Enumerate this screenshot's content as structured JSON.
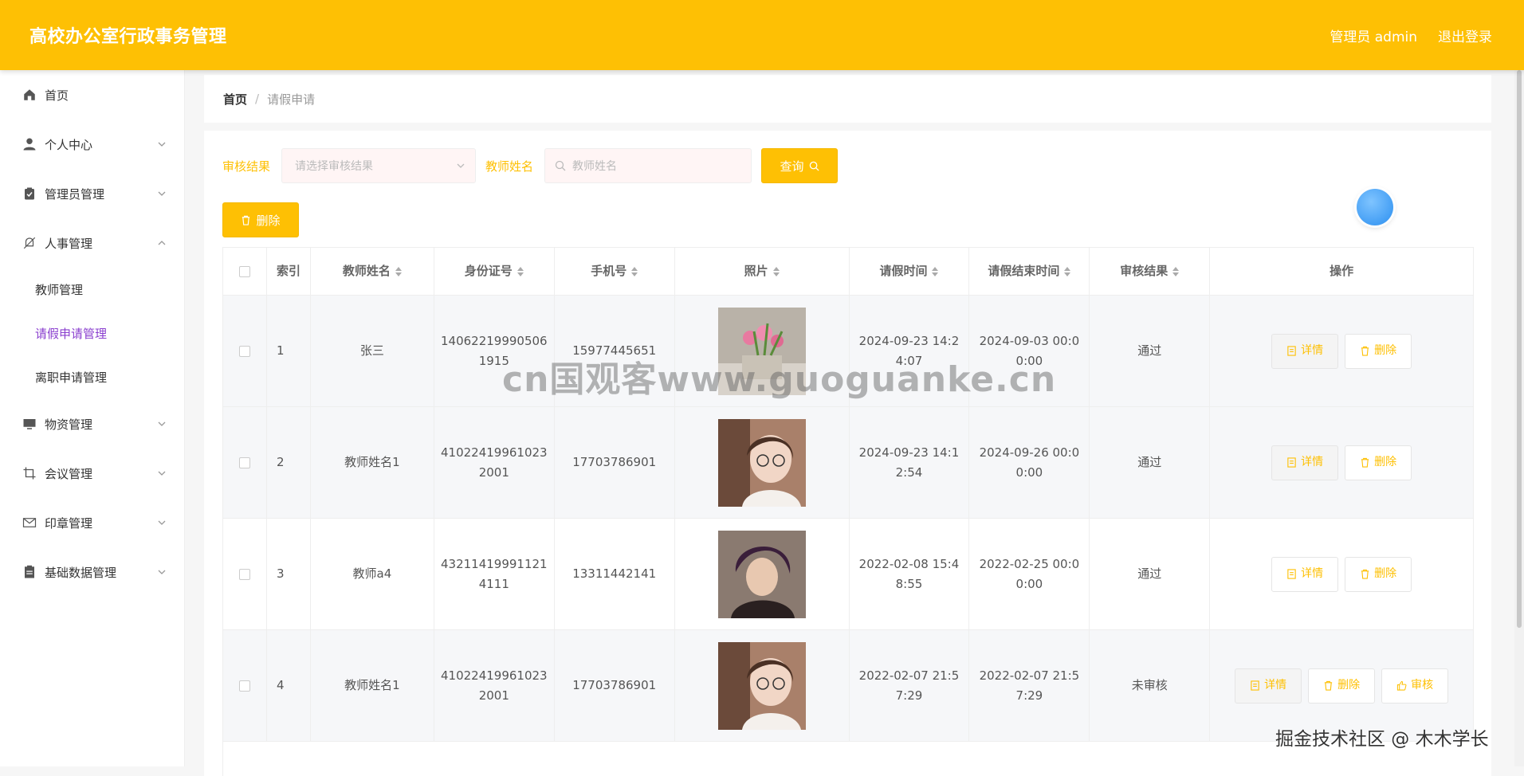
{
  "app": {
    "title": "高校办公室行政事务管理",
    "user_label": "管理员 admin",
    "logout_label": "退出登录"
  },
  "sidebar": {
    "items": [
      {
        "label": "首页",
        "icon": "home-icon"
      },
      {
        "label": "个人中心",
        "icon": "user-icon"
      },
      {
        "label": "管理员管理",
        "icon": "clipboard-check-icon"
      },
      {
        "label": "人事管理",
        "icon": "bell-off-icon"
      },
      {
        "label": "物资管理",
        "icon": "monitor-icon"
      },
      {
        "label": "会议管理",
        "icon": "crop-icon"
      },
      {
        "label": "印章管理",
        "icon": "mail-icon"
      },
      {
        "label": "基础数据管理",
        "icon": "document-icon"
      }
    ],
    "sub_items": [
      "教师管理",
      "请假申请管理",
      "离职申请管理"
    ]
  },
  "breadcrumb": {
    "home": "首页",
    "sep": "/",
    "current": "请假申请"
  },
  "search": {
    "result_label": "审核结果",
    "result_placeholder": "请选择审核结果",
    "name_label": "教师姓名",
    "name_placeholder": "教师姓名",
    "query_label": "查询"
  },
  "toolbar": {
    "delete_label": "删除"
  },
  "table": {
    "columns": [
      "索引",
      "教师姓名",
      "身份证号",
      "手机号",
      "照片",
      "请假时间",
      "请假结束时间",
      "审核结果",
      "操作"
    ],
    "rows": [
      {
        "index": "1",
        "name": "张三",
        "id_no": "140622199905061915",
        "phone": "15977445651",
        "start": "2024-09-23 14:24:07",
        "end": "2024-09-03 00:00:00",
        "result": "通过",
        "photo": "flowers"
      },
      {
        "index": "2",
        "name": "教师姓名1",
        "id_no": "410224199610232001",
        "phone": "17703786901",
        "start": "2024-09-23 14:12:54",
        "end": "2024-09-26 00:00:00",
        "result": "通过",
        "photo": "girl"
      },
      {
        "index": "3",
        "name": "教师a4",
        "id_no": "432114199911214111",
        "phone": "13311442141",
        "start": "2022-02-08 15:48:55",
        "end": "2022-02-25 00:00:00",
        "result": "通过",
        "photo": "boy"
      },
      {
        "index": "4",
        "name": "教师姓名1",
        "id_no": "410224199610232001",
        "phone": "17703786901",
        "start": "2022-02-07 21:57:29",
        "end": "2022-02-07 21:57:29",
        "result": "未审核",
        "photo": "girl"
      }
    ],
    "op_detail": "详情",
    "op_delete": "删除",
    "op_audit": "审核"
  },
  "watermark": "cn国观客www.guoguanke.cn",
  "footer_mark": "掘金技术社区 @ 木木学长",
  "colors": {
    "accent": "#fec004",
    "active_sub": "#8a3fcf"
  }
}
